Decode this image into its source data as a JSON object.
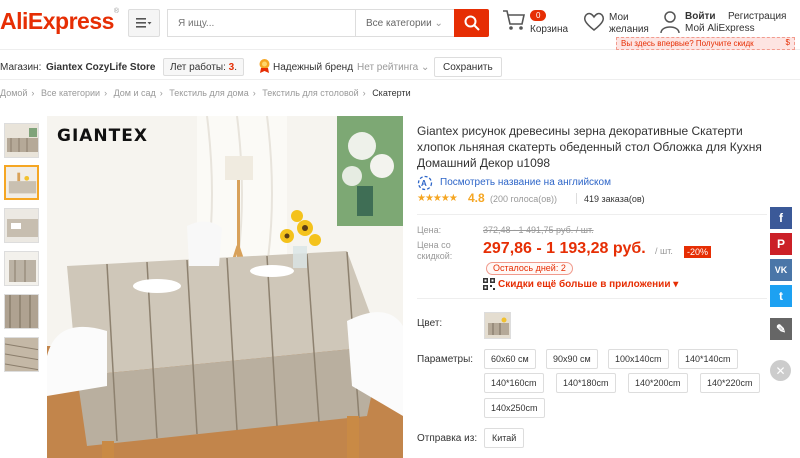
{
  "header": {
    "logo": "AliExpress",
    "logo_tm": "®",
    "search_placeholder": "Я ищу...",
    "search_category": "Все категории",
    "cart_count": "0",
    "cart_label": "Корзина",
    "wish_label": "Мои желания",
    "signin": "Войти",
    "register": "Регистрация",
    "my_ali": "Мой AliExpress",
    "newbie_text": "Вы здесь впервые? Получите скидк",
    "newbie_price": "$"
  },
  "store": {
    "label": "Магазин:",
    "name": "Giantex CozyLife Store",
    "years_label": "Лет работы:",
    "years_value": "3",
    "years_dot": ".",
    "brand": "Надежный бренд",
    "rating": "Нет рейтинга",
    "save": "Сохранить"
  },
  "breadcrumb": [
    "Домой",
    "Все категории",
    "Дом и сад",
    "Текстиль для дома",
    "Текстиль для столовой",
    "Скатерти"
  ],
  "image": {
    "watermark": "GIANTEX"
  },
  "product": {
    "title": "Giantex рисунок древесины зерна декоративные Скатерти хлопок льняная скатерть обеденный стол Обложка для Кухня Домашний Декор u1098",
    "translate": "Посмотреть название на английском",
    "stars": "★★★★★",
    "score": "4.8",
    "votes": "(200 голоса(ов))",
    "orders": "419 заказа(ов)",
    "price_label": "Цена:",
    "old_price": "372,48 - 1 491,75 руб. / шт.",
    "discount_label": "Цена со скидкой:",
    "new_price": "297,86 - 1 193,28 руб.",
    "per_unit": "/ шт.",
    "discount_pct": "-20%",
    "days_left": "Осталось дней: 2",
    "app_discount": "Скидки ещё больше в приложении",
    "color_label": "Цвет:",
    "params_label": "Параметры:",
    "sizes": [
      "60x60 см",
      "90x90 см",
      "100x140cm",
      "140*140cm",
      "140*160cm",
      "140*180cm",
      "140*200cm",
      "140*220cm",
      "140x250cm"
    ],
    "ship_label": "Отправка из:",
    "ship_from": "Китай"
  },
  "social": [
    "f",
    "P",
    "VK",
    "t",
    "✎"
  ],
  "colors": {
    "accent": "#e62e04",
    "star": "#f5a623",
    "link": "#2d65c8",
    "facebook": "#3b5998",
    "pinterest": "#cb2027",
    "vk": "#4a76a8",
    "twitter": "#1da1f2",
    "edit": "#666666"
  }
}
